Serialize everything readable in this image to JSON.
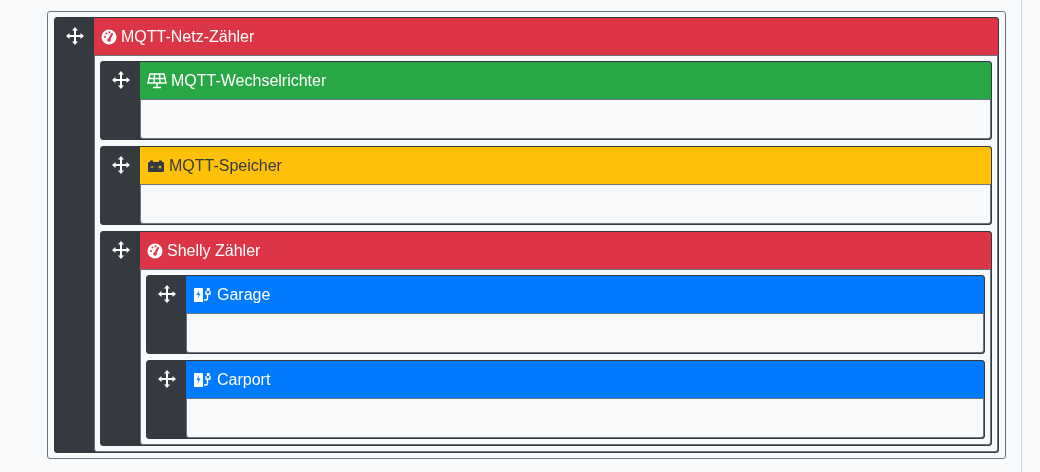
{
  "tree": [
    {
      "name": "MQTT-Netz-Zähler",
      "kind": "counter",
      "children": [
        {
          "name": "MQTT-Wechselrichter",
          "kind": "inverter"
        },
        {
          "name": "MQTT-Speicher",
          "kind": "battery"
        },
        {
          "name": "Shelly Zähler",
          "kind": "counter",
          "children": [
            {
              "name": "Garage",
              "kind": "charger"
            },
            {
              "name": "Carport",
              "kind": "charger"
            }
          ]
        }
      ]
    }
  ]
}
